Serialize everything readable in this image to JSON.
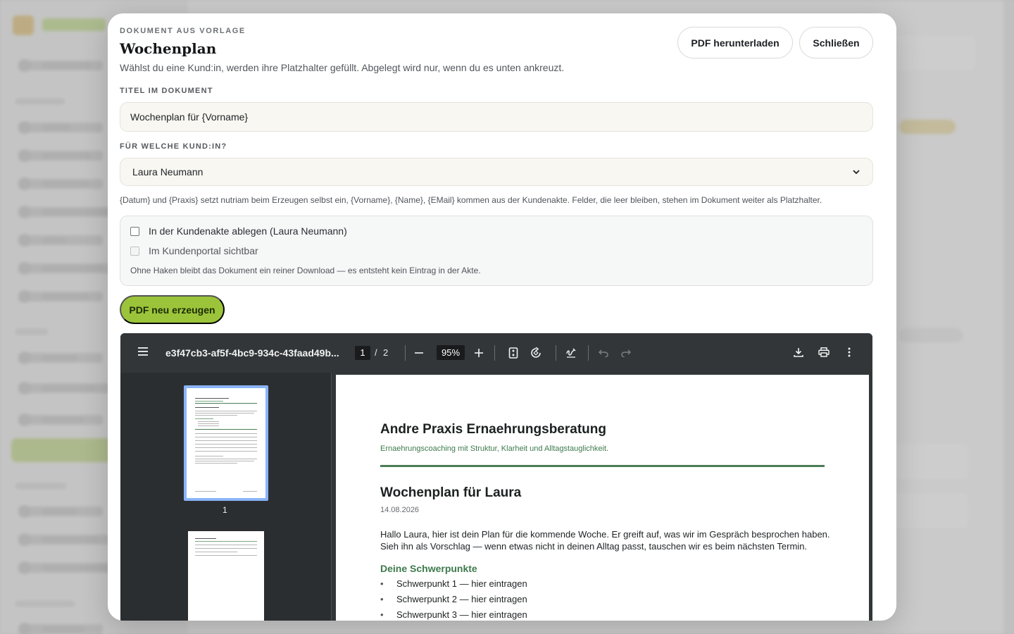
{
  "modal": {
    "eyebrow": "DOKUMENT AUS VORLAGE",
    "title": "Wochenplan",
    "subtitle": "Wählst du eine Kund:in, werden ihre Platzhalter gefüllt. Abgelegt wird nur, wenn du es unten ankreuzt.",
    "download_button": "PDF herunterladen",
    "close_button": "Schließen",
    "title_label": "TITEL IM DOKUMENT",
    "title_value": "Wochenplan für {Vorname}",
    "client_label": "FÜR WELCHE KUND:IN?",
    "client_selected": "Laura Neumann",
    "hint": "{Datum} und {Praxis} setzt nutriam beim Erzeugen selbst ein, {Vorname}, {Name}, {EMail} kommen aus der Kundenakte. Felder, die leer bleiben, stehen im Dokument weiter als Platzhalter.",
    "checkbox_file": "In der Kundenakte ablegen (Laura Neumann)",
    "checkbox_file_checked": false,
    "checkbox_portal": "Im Kundenportal sichtbar",
    "checkbox_portal_checked": false,
    "checkbox_note": "Ohne Haken bleibt das Dokument ein reiner Download — es entsteht kein Eintrag in der Akte.",
    "regenerate_button": "PDF neu erzeugen"
  },
  "viewer": {
    "filename": "e3f47cb3-af5f-4bc9-934c-43faad49b...",
    "current_page": "1",
    "page_separator": "/",
    "page_count": "2",
    "zoom": "95%",
    "thumbnail_1_label": "1",
    "icons": [
      "menu-icon",
      "zoom-out-icon",
      "zoom-in-icon",
      "fit-page-icon",
      "rotate-icon",
      "annotate-icon",
      "undo-icon",
      "redo-icon",
      "download-icon",
      "print-icon",
      "more-icon"
    ]
  },
  "document": {
    "org_name": "Andre Praxis Ernaehrungsberatung",
    "tagline": "Ernaehrungscoaching mit Struktur, Klarheit und Alltagstauglichkeit.",
    "heading": "Wochenplan für Laura",
    "date": "14.08.2026",
    "intro": "Hallo Laura, hier ist dein Plan für die kommende Woche. Er greift auf, was wir im Gespräch besprochen haben. Sieh ihn als Vorschlag — wenn etwas nicht in deinen Alltag passt, tauschen wir es beim nächsten Termin.",
    "section_title": "Deine Schwerpunkte",
    "bullet_char": "•",
    "items": [
      "Schwerpunkt 1 — hier eintragen",
      "Schwerpunkt 2 — hier eintragen",
      "Schwerpunkt 3 — hier eintragen"
    ]
  },
  "colors": {
    "accent": "#9bc43a",
    "doc_green": "#3d7a4c",
    "viewer_bg": "#323639",
    "thumb_highlight": "#8ab4f8"
  }
}
